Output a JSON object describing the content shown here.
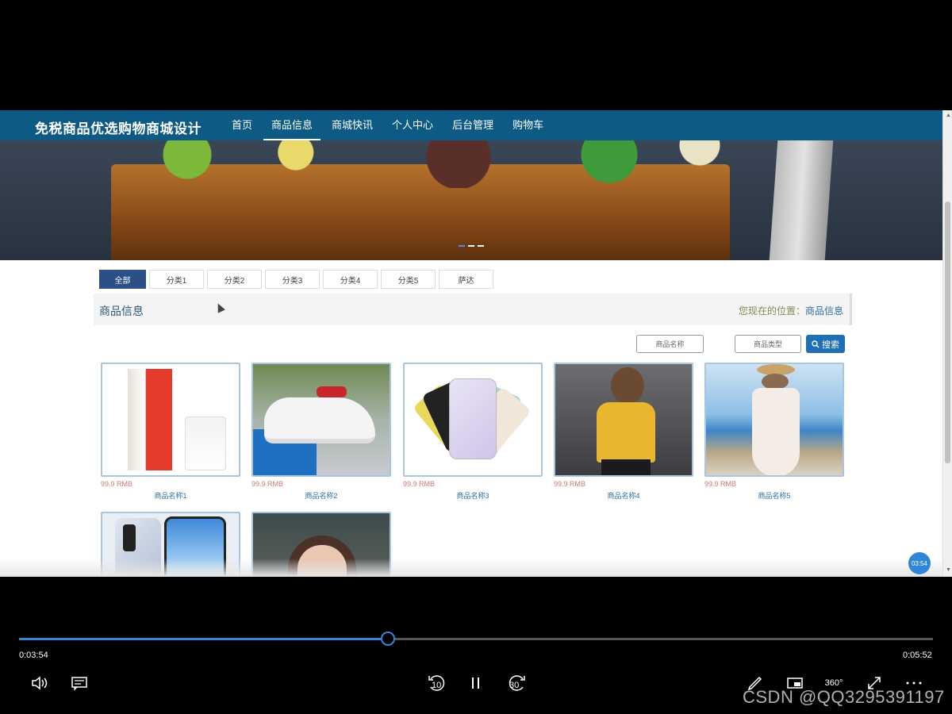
{
  "nav": {
    "site_title": "免税商品优选购物商城设计",
    "links": [
      {
        "label": "首页"
      },
      {
        "label": "商品信息"
      },
      {
        "label": "商城快讯"
      },
      {
        "label": "个人中心"
      },
      {
        "label": "后台管理"
      },
      {
        "label": "购物车"
      }
    ]
  },
  "categories": [
    "全部",
    "分类1",
    "分类2",
    "分类3",
    "分类4",
    "分类5",
    "萨达"
  ],
  "section": {
    "title": "商品信息",
    "breadcrumb_prefix": "您现在的位置：",
    "breadcrumb_current": "商品信息"
  },
  "search": {
    "name_placeholder": "商品名称",
    "type_placeholder": "商品类型",
    "button_label": "搜索"
  },
  "products": [
    {
      "price": "99.9 RMB",
      "name": "商品名称1",
      "image": "milk-carton"
    },
    {
      "price": "99.9 RMB",
      "name": "商品名称2",
      "image": "sneakers"
    },
    {
      "price": "99.9 RMB",
      "name": "商品名称3",
      "image": "smartphones"
    },
    {
      "price": "99.9 RMB",
      "name": "商品名称4",
      "image": "woman-yellow-top"
    },
    {
      "price": "99.9 RMB",
      "name": "商品名称5",
      "image": "woman-white-dress"
    },
    {
      "image": "smartphone-blue"
    },
    {
      "image": "woman-portrait"
    }
  ],
  "overlay_time": "03:54",
  "player": {
    "current_time": "0:03:54",
    "total_time": "0:05:52",
    "progress": 0.4034,
    "rewind_label": "10",
    "forward_label": "30",
    "vr_label": "360°"
  },
  "watermark": "CSDN @QQ3295391197",
  "colors": {
    "nav": "#0d5a85",
    "accent": "#1f6fb4",
    "progress": "#3a86d6"
  }
}
